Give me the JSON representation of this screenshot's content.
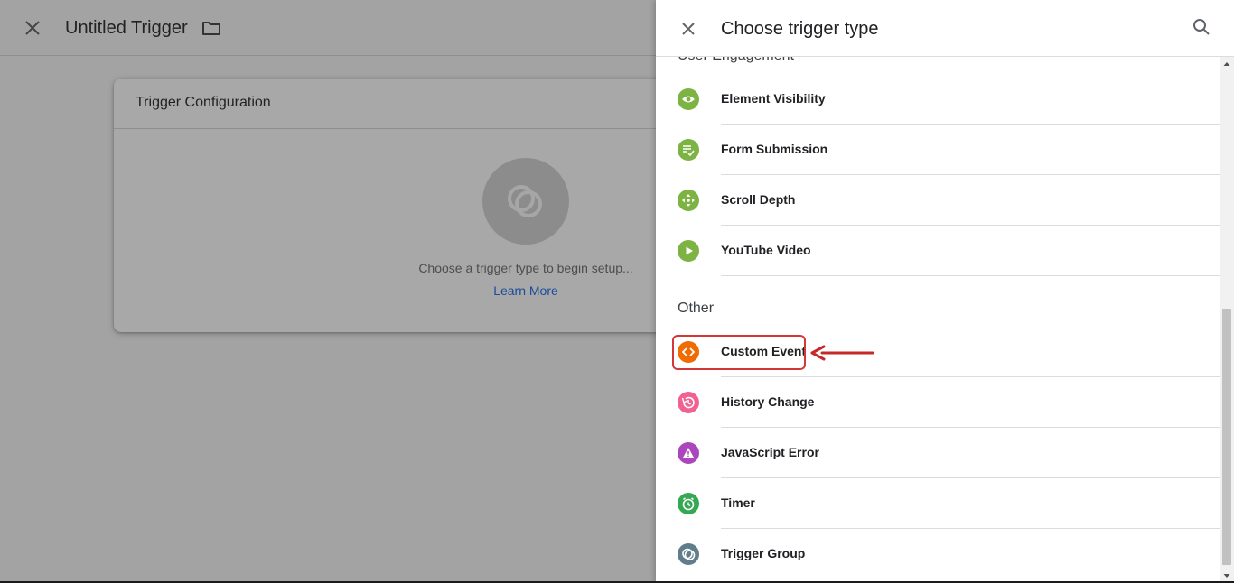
{
  "editor": {
    "title": "Untitled Trigger",
    "card_title": "Trigger Configuration",
    "hint": "Choose a trigger type to begin setup...",
    "link": "Learn More"
  },
  "panel": {
    "title": "Choose trigger type",
    "sections": {
      "engagement": "User Engagement",
      "other": "Other"
    },
    "items": [
      {
        "label": "Element Visibility",
        "icon": "eye-icon",
        "color": "#7cb342"
      },
      {
        "label": "Form Submission",
        "icon": "form-submit-icon",
        "color": "#7cb342"
      },
      {
        "label": "Scroll Depth",
        "icon": "scroll-depth-icon",
        "color": "#7cb342"
      },
      {
        "label": "YouTube Video",
        "icon": "play-icon",
        "color": "#7cb342"
      },
      {
        "label": "Custom Event",
        "icon": "code-icon",
        "color": "#ef6c00"
      },
      {
        "label": "History Change",
        "icon": "history-icon",
        "color": "#f06292"
      },
      {
        "label": "JavaScript Error",
        "icon": "warning-icon",
        "color": "#ab47bc"
      },
      {
        "label": "Timer",
        "icon": "alarm-icon",
        "color": "#34a853"
      },
      {
        "label": "Trigger Group",
        "icon": "trigger-group-icon",
        "color": "#607d8b"
      }
    ]
  },
  "colors": {
    "highlight": "#d3373a",
    "link": "#1a73e8"
  }
}
